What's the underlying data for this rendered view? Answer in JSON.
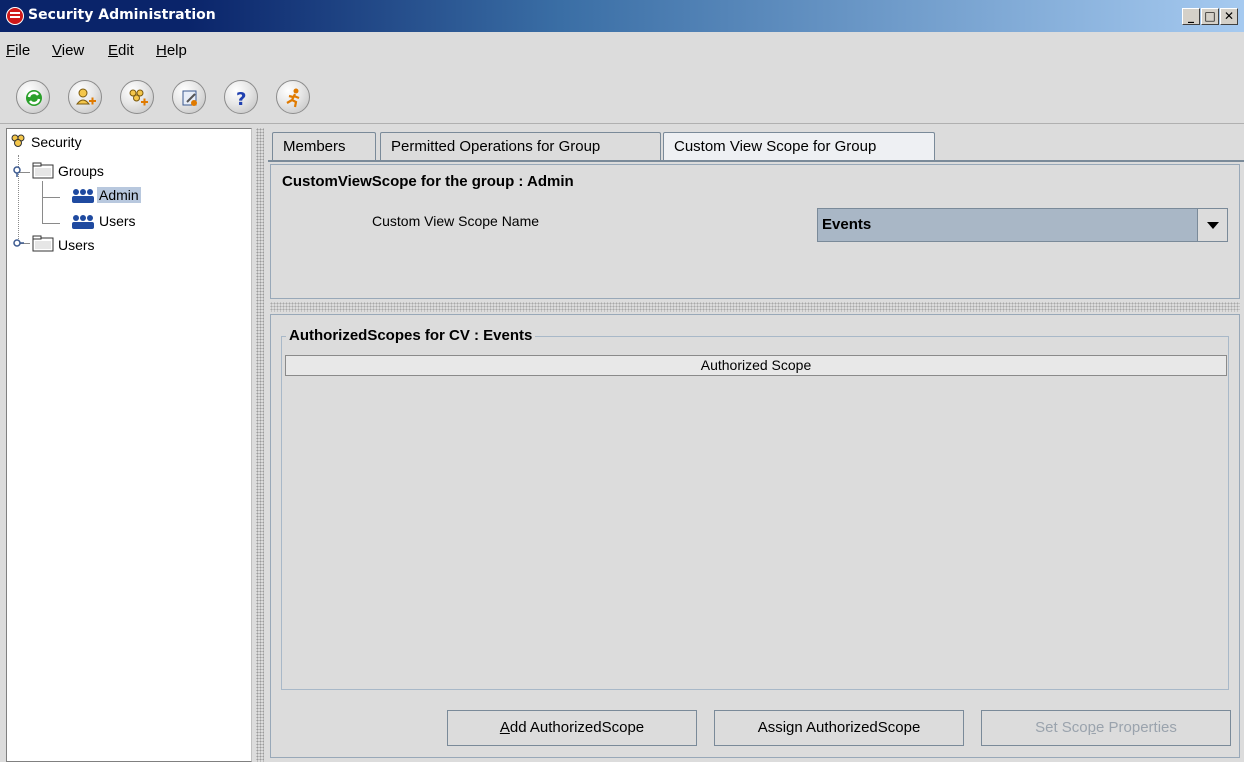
{
  "window": {
    "title": "Security Administration"
  },
  "menu": {
    "items": [
      {
        "label": "File",
        "mnemonic": "F",
        "rest": "ile"
      },
      {
        "label": "View",
        "mnemonic": "V",
        "rest": "iew"
      },
      {
        "label": "Edit",
        "mnemonic": "E",
        "rest": "dit"
      },
      {
        "label": "Help",
        "mnemonic": "H",
        "rest": "elp"
      }
    ]
  },
  "toolbar": {
    "icons": [
      "refresh-icon",
      "add-user-icon",
      "add-group-icon",
      "edit-properties-icon",
      "help-icon",
      "exit-icon"
    ]
  },
  "tree": {
    "root": "Security",
    "groups_label": "Groups",
    "group_admin": "Admin",
    "group_users": "Users",
    "users_label": "Users"
  },
  "tabs": {
    "members": "Members",
    "permitted": "Permitted Operations for Group",
    "custom_view": "Custom View Scope for Group"
  },
  "scope_panel": {
    "title": "CustomViewScope for  the group : Admin",
    "field_label": "Custom View Scope Name",
    "selected_value": "Events"
  },
  "authorized_panel": {
    "title": "AuthorizedScopes for CV : Events",
    "column_header": "Authorized Scope",
    "rows": []
  },
  "buttons": {
    "add": {
      "before": "",
      "mnemonic": "A",
      "after": "dd AuthorizedScope"
    },
    "assign": {
      "label": "Assign AuthorizedScope"
    },
    "set": {
      "before": "Set Sco",
      "mnemonic": "p",
      "after": "e Properties"
    }
  },
  "colors": {
    "title_bar_start": "#0a246a",
    "selection": "#b8c8de",
    "combo_bg": "#a9b7c6"
  }
}
